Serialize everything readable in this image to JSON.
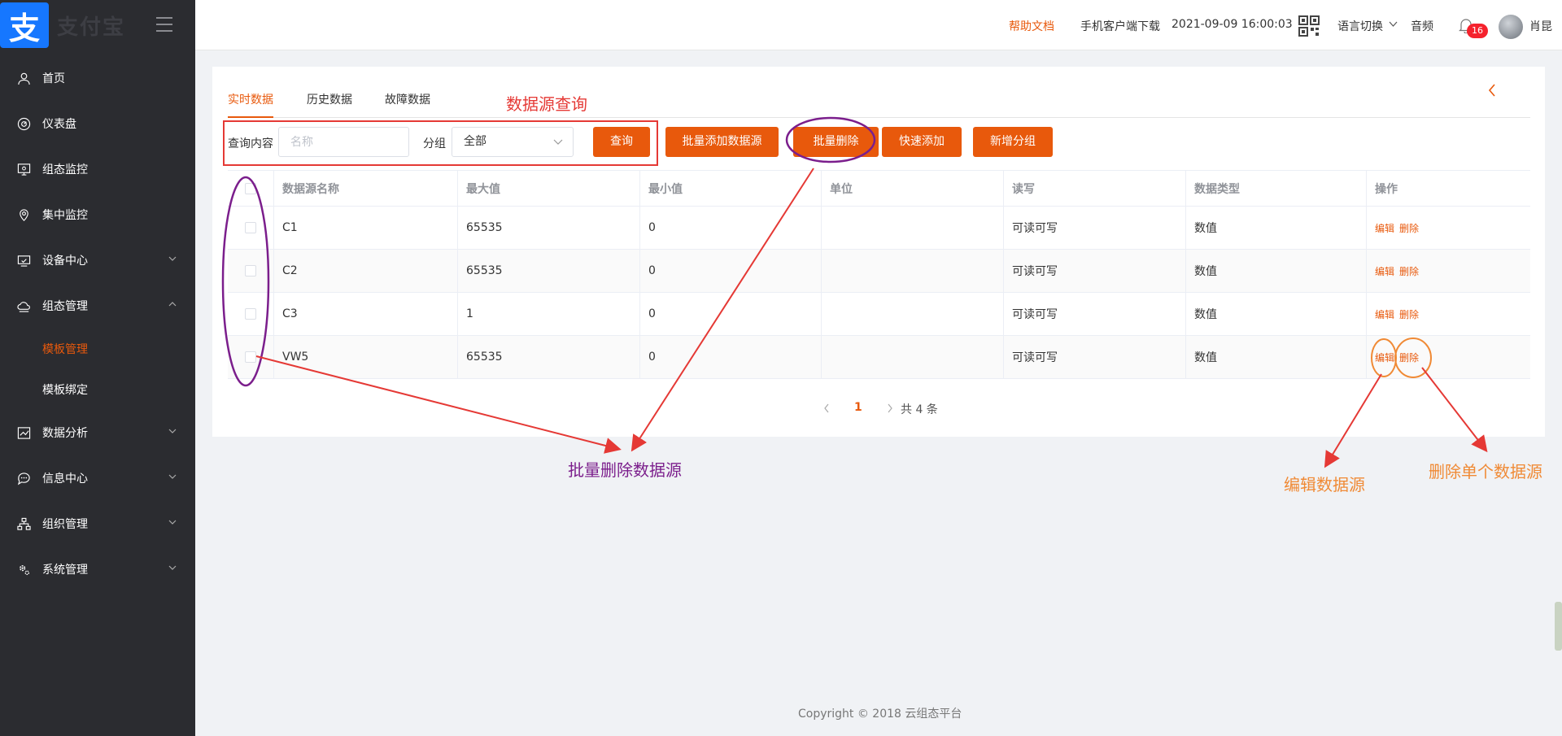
{
  "app": {
    "logo_glyph": "支",
    "logo_text": "支付宝"
  },
  "sidebar": {
    "items": [
      {
        "label": "首页",
        "icon": "user-icon"
      },
      {
        "label": "仪表盘",
        "icon": "gauge-icon"
      },
      {
        "label": "组态监控",
        "icon": "monitor-icon"
      },
      {
        "label": "集中监控",
        "icon": "location-icon"
      },
      {
        "label": "设备中心",
        "icon": "device-icon"
      },
      {
        "label": "组态管理",
        "icon": "cloud-icon"
      },
      {
        "label": "数据分析",
        "icon": "chart-icon"
      },
      {
        "label": "信息中心",
        "icon": "message-icon"
      },
      {
        "label": "组织管理",
        "icon": "org-icon"
      },
      {
        "label": "系统管理",
        "icon": "gear-icon"
      }
    ],
    "sub_items": [
      {
        "label": "模板管理"
      },
      {
        "label": "模板绑定"
      }
    ]
  },
  "header": {
    "help": "帮助文档",
    "app_download": "手机客户端下载",
    "datetime": "2021-09-09 16:00:03",
    "language": "语言切换",
    "audio": "音频",
    "notifications": "16",
    "user": "肖昆"
  },
  "tabs": [
    "实时数据",
    "历史数据",
    "故障数据"
  ],
  "filter": {
    "query_label": "查询内容",
    "query_placeholder": "名称",
    "group_label": "分组",
    "group_value": "全部",
    "search_button": "查询"
  },
  "actions": {
    "batch_add": "批量添加数据源",
    "batch_delete": "批量删除",
    "quick_add": "快速添加",
    "new_group": "新增分组"
  },
  "table": {
    "headers": [
      "数据源名称",
      "最大值",
      "最小值",
      "单位",
      "读写",
      "数据类型",
      "操作"
    ],
    "rows": [
      {
        "name": "C1",
        "max": "65535",
        "min": "0",
        "unit": "",
        "rw": "可读可写",
        "type": "数值"
      },
      {
        "name": "C2",
        "max": "65535",
        "min": "0",
        "unit": "",
        "rw": "可读可写",
        "type": "数值"
      },
      {
        "name": "C3",
        "max": "1",
        "min": "0",
        "unit": "",
        "rw": "可读可写",
        "type": "数值"
      },
      {
        "name": "VW5",
        "max": "65535",
        "min": "0",
        "unit": "",
        "rw": "可读可写",
        "type": "数值"
      }
    ],
    "edit_label": "编辑",
    "delete_label": "删除"
  },
  "pagination": {
    "current": "1",
    "total": "共 4 条"
  },
  "footer": "Copyright © 2018 云组态平台",
  "annotations": {
    "query": "数据源查询",
    "batch_delete": "批量删除数据源",
    "edit": "编辑数据源",
    "delete_one": "删除单个数据源"
  },
  "colors": {
    "accent": "#e8590c",
    "sidebar_bg": "#2b2c30",
    "red_annotation": "#e53935",
    "purple_annotation": "#7b1e8c",
    "orange_annotation": "#f08a35"
  }
}
